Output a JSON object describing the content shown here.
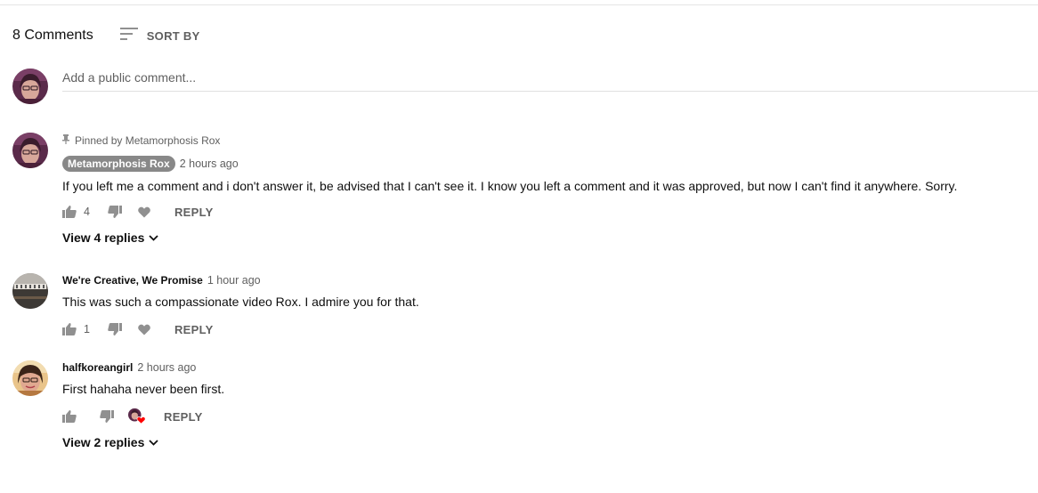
{
  "header": {
    "count_label": "8 Comments",
    "sort_label": "SORT BY"
  },
  "composer": {
    "placeholder": "Add a public comment..."
  },
  "comments": [
    {
      "pinned_label": "Pinned by Metamorphosis Rox",
      "author": "Metamorphosis Rox",
      "author_is_creator": true,
      "time": "2 hours ago",
      "text": "If you left me a comment and i don't answer it, be advised that I can't see it. I know you left a comment and it was approved, but now I can't find it anywhere. Sorry.",
      "likes": "4",
      "reply_label": "REPLY",
      "view_replies_label": "View 4 replies"
    },
    {
      "author": "We're Creative, We Promise",
      "time": "1 hour ago",
      "text": "This was such a compassionate video Rox. I admire you for that.",
      "likes": "1",
      "reply_label": "REPLY"
    },
    {
      "author": "halfkoreangirl",
      "time": "2 hours ago",
      "text": "First hahaha never been first.",
      "likes": "",
      "hearted_by_creator": true,
      "reply_label": "REPLY",
      "view_replies_label": "View 2 replies"
    }
  ],
  "icons": {
    "sort": "sort-icon",
    "pin": "pin-icon",
    "like": "thumbs-up-icon",
    "dislike": "thumbs-down-icon",
    "heart": "heart-icon",
    "chevron": "chevron-down-icon"
  },
  "colors": {
    "secondary_text": "#606060",
    "creator_badge": "#888888",
    "heart_red": "#ff0000"
  }
}
